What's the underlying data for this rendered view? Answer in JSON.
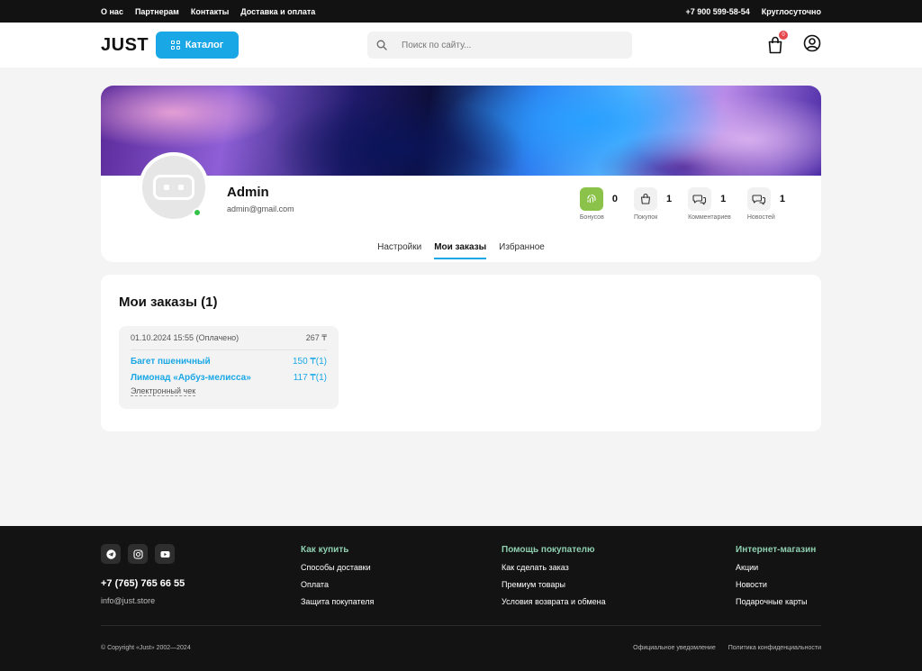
{
  "topbar": {
    "links": [
      "О нас",
      "Партнерам",
      "Контакты",
      "Доставка и оплата"
    ],
    "phone": "+7 900 599-58-54",
    "hours": "Круглосуточно"
  },
  "header": {
    "logo": "JUST",
    "catalog_label": "Каталог",
    "search_placeholder": "Поиск по сайту...",
    "cart_count": "0"
  },
  "profile": {
    "name": "Admin",
    "email": "admin@gmail.com",
    "stats": [
      {
        "icon": "fingerprint-icon",
        "value": "0",
        "label": "Бонусов"
      },
      {
        "icon": "bag-icon",
        "value": "1",
        "label": "Покупок"
      },
      {
        "icon": "comments-icon",
        "value": "1",
        "label": "Комментариев"
      },
      {
        "icon": "news-icon",
        "value": "1",
        "label": "Новостей"
      }
    ],
    "tabs": [
      "Настройки",
      "Мои заказы",
      "Избранное"
    ],
    "active_tab": "Мои заказы"
  },
  "orders": {
    "title": "Мои заказы (1)",
    "list": [
      {
        "date_status": "01.10.2024 15:55 (Оплачено)",
        "total": "267 ₸",
        "items": [
          {
            "name": "Багет пшеничный",
            "price": "150 ₸(1)"
          },
          {
            "name": "Лимонад «Арбуз-мелисса»",
            "price": "117 ₸(1)"
          }
        ],
        "receipt": "Электронный чек"
      }
    ]
  },
  "footer": {
    "phone": "+7 (765) 765 66 55",
    "email": "info@just.store",
    "columns": [
      {
        "heading": "Как купить",
        "links": [
          "Способы доставки",
          "Оплата",
          "Защита покупателя"
        ]
      },
      {
        "heading": "Помощь покупателю",
        "links": [
          "Как сделать заказ",
          "Премиум товары",
          "Условия возврата и обмена"
        ]
      },
      {
        "heading": "Интернет-магазин",
        "links": [
          "Акции",
          "Новости",
          "Подарочные карты"
        ]
      }
    ],
    "copyright": "© Copyright «Just» 2002—2024",
    "legal": [
      "Официальное уведомление",
      "Политика конфиденциальности"
    ]
  },
  "colors": {
    "accent": "#19a7e6",
    "bonus": "#8bc34a",
    "online": "#35c24a",
    "footer_bg": "#131313"
  }
}
